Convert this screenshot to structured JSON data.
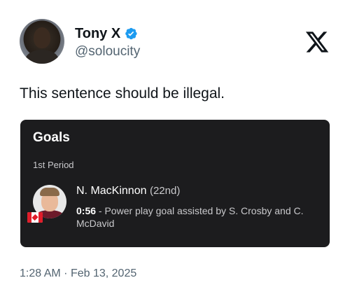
{
  "author": {
    "display_name": "Tony X",
    "handle": "@soloucity",
    "verified": true,
    "verified_color": "#1d9bf0"
  },
  "platform_logo": "x-logo-icon",
  "tweet": {
    "text": "This sentence should be illegal.",
    "time": "1:28 AM",
    "separator": "·",
    "date": "Feb 13, 2025"
  },
  "card": {
    "title": "Goals",
    "period": "1st Period",
    "goal": {
      "scorer": "N. MacKinnon",
      "goal_count": "(22nd)",
      "time": "0:56",
      "description": "- Power play goal assisted by S. Crosby and C. McDavid",
      "flag": "canada-flag-icon"
    },
    "background": "#1c1c1e"
  }
}
